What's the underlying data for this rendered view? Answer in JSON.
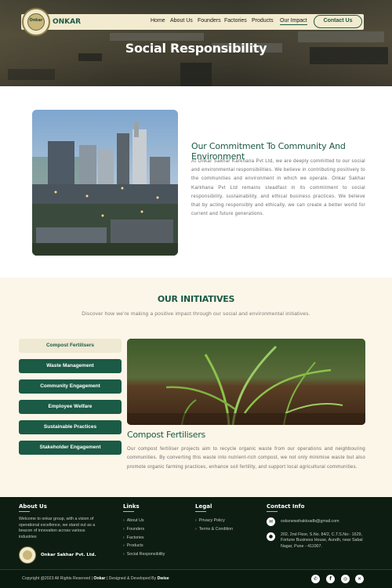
{
  "nav": {
    "brand": "ONKAR",
    "logo_text": "Onkar",
    "menu": [
      "Home",
      "About Us",
      "Founders",
      "Factories",
      "Products",
      "Our Impact"
    ],
    "contact_button": "Contact Us"
  },
  "hero": {
    "title": "Social Responsibility"
  },
  "commitment": {
    "title": "Our Commitment To Community And Environment",
    "paragraph": "At Onkar Sakhar Karkhana Pvt Ltd, we are deeply committed to our social and environmental responsibilities. We believe in contributing positively to the communities and environment in which we operate. Onkar Sakhar Karkhana Pvt Ltd remains steadfast in its commitment to social responsibility, sustainability, and ethical business practices. We believe that by acting responsibly and ethically, we can create a better world for current and future generations."
  },
  "initiatives": {
    "title": "OUR INITIATIVES",
    "subtitle": "Discover how we're making a positive impact through our social and environmental initiatives.",
    "tabs": [
      "Compost Fertilisers",
      "Waste Management",
      "Community Engagement",
      "Employee Welfare",
      "Sustainable Practices",
      "Stakeholder Engagement"
    ],
    "active_tab": "Compost Fertilisers",
    "detail_title": "Compost Fertilisers",
    "detail_paragraph": "Our compost fertiliser projects aim to recycle organic waste from our operations and neighbouring communities. By converting this waste into nutrient-rich compost, we not only minimise waste but also promote organic farming practices, enhance soil fertility, and support local agricultural communities."
  },
  "footer": {
    "about": {
      "heading": "About Us",
      "text": "Welcome to onkar group, with a vision of operational excellence, we stand out as a beacon of innovation across various industries",
      "brand": "Onkar Sakhar Pvt. Ltd."
    },
    "links": {
      "heading": "Links",
      "items": [
        "About Us",
        "Founders",
        "Factories",
        "Products",
        "Social Responsibility"
      ]
    },
    "legal": {
      "heading": "Legal",
      "items": [
        "Privacy Policy",
        "Terms & Condition"
      ]
    },
    "contact": {
      "heading": "Contact Info",
      "email": "osksnewshaktoadb@gmail.com",
      "address": "202, 2nd Floor, S.No. 84/2, C.T.S.No:- 1629, Fortune Business House, Aundh, near Sabal Nagar, Pune - 411007."
    },
    "copyright_prefix": "Copyright @2023 All Rights Reserved |",
    "copyright_brand": "Onkar",
    "copyright_mid": "| Designed & Developed By",
    "copyright_dev": "Dwise",
    "social_icons": [
      "whatsapp-icon",
      "facebook-icon",
      "instagram-icon",
      "x-icon"
    ]
  },
  "colors": {
    "primary_green": "#1b5a45",
    "cream": "#f3ebcf",
    "footer_bg": "#0d1d12",
    "gold": "#c9b67a"
  }
}
